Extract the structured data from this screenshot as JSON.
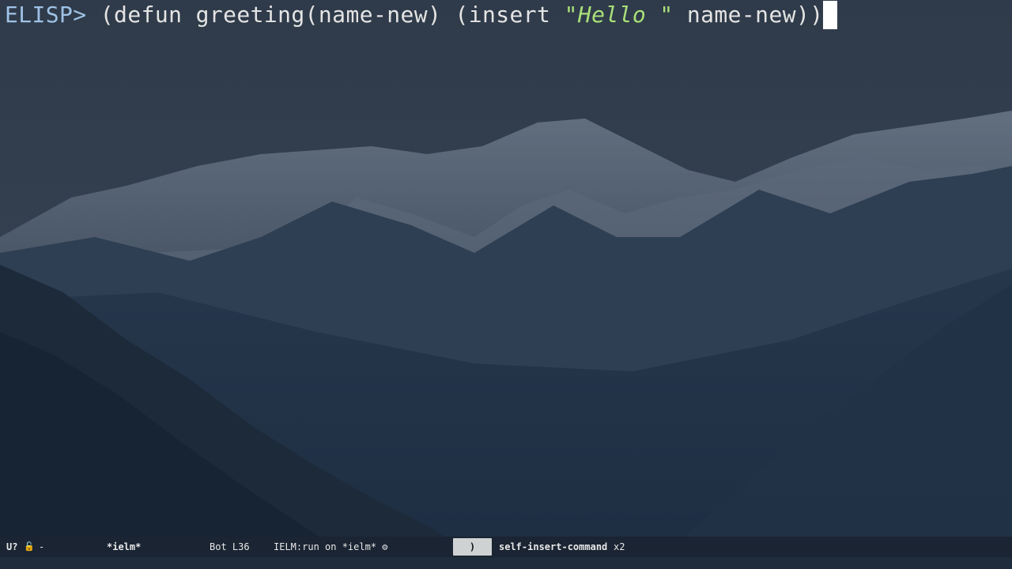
{
  "repl": {
    "prompt": "ELISP>",
    "code_before_string": " (defun greeting(name-new) (insert ",
    "string_open_quote": "\"",
    "string_word": "Hello",
    "string_close": " \"",
    "code_after_string": " name-new))"
  },
  "modeline": {
    "status": "U?",
    "lock_icon": "🔓",
    "dash": "-",
    "buffer_name": "*ielm*",
    "position": "Bot L36",
    "process": "IELM:run on *ielm* ⚙",
    "last_key": ")",
    "command": "self-insert-command",
    "repeat": "x2"
  },
  "colors": {
    "prompt": "#9fc2e6",
    "string": "#a9e079",
    "text": "#e4e4e4",
    "cursor": "#ffffff",
    "modeline_bg": "#1a2432",
    "keybox_bg": "#cfd2d2"
  }
}
